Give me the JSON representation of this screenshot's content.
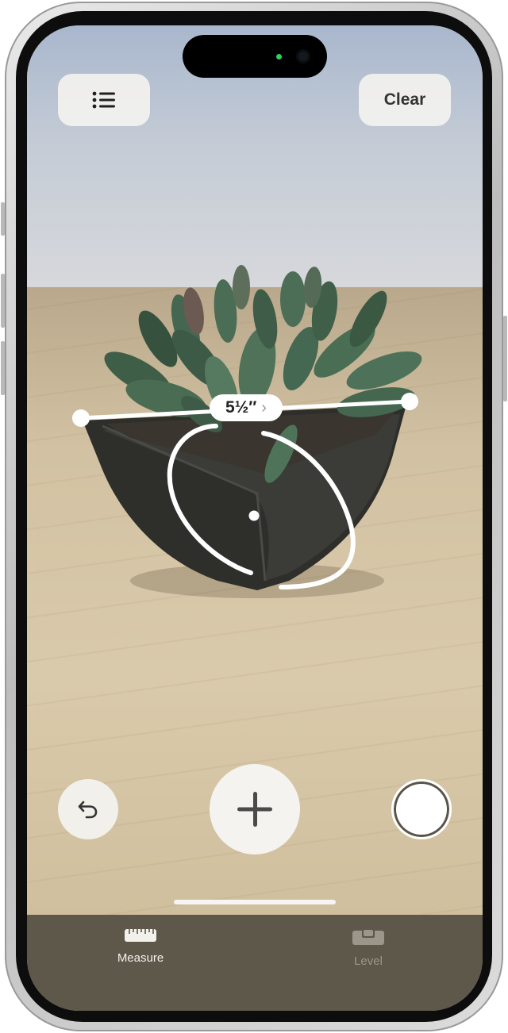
{
  "toolbar": {
    "list_icon": "list-icon",
    "clear_label": "Clear"
  },
  "measurement": {
    "value_label": "5½″",
    "detail_icon": "chevron-right-icon"
  },
  "controls": {
    "undo_icon": "undo-icon",
    "add_icon": "plus-icon",
    "capture_icon": "shutter-icon"
  },
  "tabs": [
    {
      "label": "Measure",
      "icon": "ruler-icon",
      "selected": true
    },
    {
      "label": "Level",
      "icon": "level-icon",
      "selected": false
    }
  ],
  "colors": {
    "tabbar": "#5e584a",
    "button_bg": "#f3f2ef",
    "active_tab": "#f3f1ec",
    "inactive_tab": "#9c968a"
  }
}
